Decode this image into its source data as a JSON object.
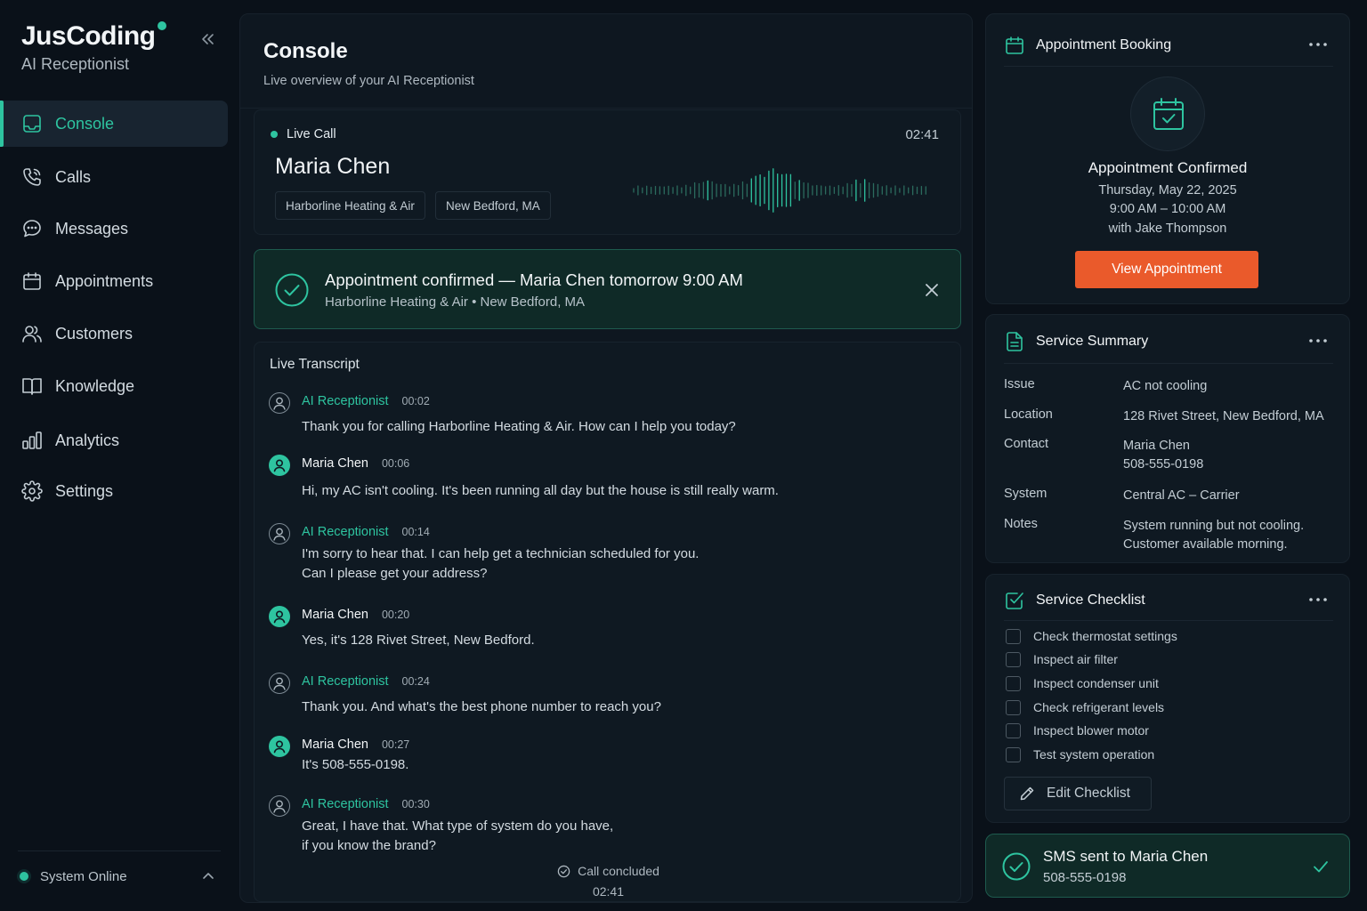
{
  "brand": {
    "name": "JusCoding",
    "subtitle": "AI Receptionist"
  },
  "nav": [
    {
      "label": "Console",
      "icon": "console-icon",
      "active": true
    },
    {
      "label": "Calls",
      "icon": "phone-icon"
    },
    {
      "label": "Messages",
      "icon": "message-icon"
    },
    {
      "label": "Appointments",
      "icon": "calendar-icon"
    },
    {
      "label": "Customers",
      "icon": "users-icon"
    },
    {
      "label": "Knowledge",
      "icon": "book-icon"
    },
    {
      "label": "Analytics",
      "icon": "bar-chart-icon"
    },
    {
      "label": "Settings",
      "icon": "gear-icon"
    }
  ],
  "system_status": "System Online",
  "console": {
    "title": "Console",
    "subtitle": "Live overview of your AI Receptionist"
  },
  "live_call": {
    "label": "Live Call",
    "timer": "02:41",
    "caller": "Maria Chen",
    "tags": [
      "Harborline Heating & Air",
      "New Bedford, MA"
    ]
  },
  "confirmation": {
    "title": "Appointment confirmed — Maria Chen tomorrow 9:00 AM",
    "subtitle": "Harborline Heating & Air • New Bedford, MA"
  },
  "transcript": {
    "title": "Live Transcript",
    "messages": [
      {
        "speaker": "AI Receptionist",
        "role": "ai",
        "time": "00:02",
        "lines": [
          "Thank you for calling Harborline Heating & Air. How can I help you today?"
        ]
      },
      {
        "speaker": "Maria Chen",
        "role": "user",
        "time": "00:06",
        "lines": [
          "Hi, my AC isn't cooling. It's been running all day but the house is still really warm."
        ]
      },
      {
        "speaker": "AI Receptionist",
        "role": "ai",
        "time": "00:14",
        "lines": [
          "I'm sorry to hear that. I can help get a technician scheduled for you.",
          "Can I please get your address?"
        ]
      },
      {
        "speaker": "Maria Chen",
        "role": "user",
        "time": "00:20",
        "lines": [
          "Yes, it's 128 Rivet Street, New Bedford."
        ]
      },
      {
        "speaker": "AI Receptionist",
        "role": "ai",
        "time": "00:24",
        "lines": [
          "Thank you. And what's the best phone number to reach you?"
        ]
      },
      {
        "speaker": "Maria Chen",
        "role": "user",
        "time": "00:27",
        "lines": [
          "It's 508-555-0198."
        ]
      },
      {
        "speaker": "AI Receptionist",
        "role": "ai",
        "time": "00:30",
        "lines": [
          "Great, I have that. What type of system do you have,",
          "if you know the brand?"
        ]
      }
    ],
    "concluded_label": "Call concluded",
    "concluded_time": "02:41"
  },
  "booking": {
    "title": "Appointment Booking",
    "status": "Appointment Confirmed",
    "date": "Thursday, May 22, 2025",
    "time": "9:00 AM – 10:00 AM",
    "with": "with Jake Thompson",
    "button": "View Appointment",
    "button_color": "#ea5a2b"
  },
  "summary": {
    "title": "Service Summary",
    "rows": [
      {
        "key": "Issue",
        "value": [
          "AC not cooling"
        ]
      },
      {
        "key": "Location",
        "value": [
          "128 Rivet Street, New Bedford, MA"
        ]
      },
      {
        "key": "Contact",
        "value": [
          "Maria Chen",
          "508-555-0198"
        ]
      },
      {
        "key": "System",
        "value": [
          "Central AC – Carrier"
        ]
      },
      {
        "key": "Notes",
        "value": [
          "System running but not cooling.",
          "Customer available morning."
        ]
      }
    ]
  },
  "checklist": {
    "title": "Service Checklist",
    "items": [
      "Check thermostat settings",
      "Inspect air filter",
      "Inspect condenser unit",
      "Check refrigerant levels",
      "Inspect blower motor",
      "Test system operation"
    ],
    "edit_label": "Edit Checklist"
  },
  "sms": {
    "title": "SMS sent to Maria Chen",
    "phone": "508-555-0198"
  },
  "colors": {
    "accent": "#2ec4a0",
    "background": "#0a1119",
    "panel": "#0f1922",
    "success_panel": "#0f2a27"
  }
}
